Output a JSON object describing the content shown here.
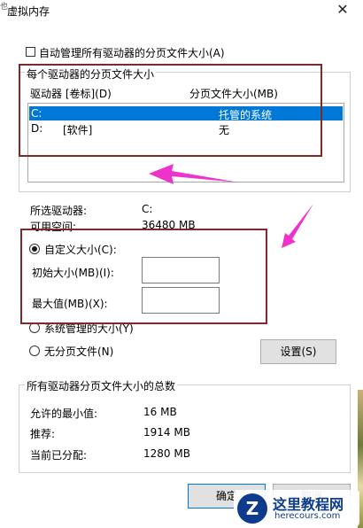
{
  "window": {
    "title": "虚拟内存"
  },
  "side_mark": "也",
  "auto_manage": {
    "label": "自动管理所有驱动器的分页文件大小(A)",
    "checked": false
  },
  "drive_group": {
    "title": "每个驱动器的分页文件大小",
    "col_drive": "驱动器 [卷标](D)",
    "col_size": "分页文件大小(MB)",
    "rows": [
      {
        "drive": "C:",
        "label": "",
        "size": "托管的系统",
        "selected": true
      },
      {
        "drive": "D:",
        "label": "[软件]",
        "size": "无",
        "selected": false
      }
    ]
  },
  "selected_info": {
    "drive_label": "所选驱动器:",
    "drive_value": "C:",
    "free_label": "可用空间:",
    "free_value": "36480 MB"
  },
  "options": {
    "custom_label": "自定义大小(C):",
    "initial_label": "初始大小(MB)(I):",
    "initial_value": "",
    "max_label": "最大值(MB)(X):",
    "max_value": "",
    "system_label": "系统管理的大小(Y)",
    "none_label": "无分页文件(N)",
    "set_button": "设置(S)",
    "selected": "custom"
  },
  "totals": {
    "title": "所有驱动器分页文件大小的总数",
    "min_label": "允许的最小值:",
    "min_value": "16 MB",
    "recommended_label": "推荐:",
    "recommended_value": "1914 MB",
    "current_label": "当前已分配:",
    "current_value": "1280 MB"
  },
  "buttons": {
    "ok": "确定",
    "cancel": "取消"
  },
  "watermark": {
    "name": "这里教程网",
    "url": "herecours.com",
    "letter": "Z"
  },
  "colors": {
    "selection": "#0078d7",
    "annotation_box": "#7e2a2a",
    "arrow": "#ee33cc"
  }
}
